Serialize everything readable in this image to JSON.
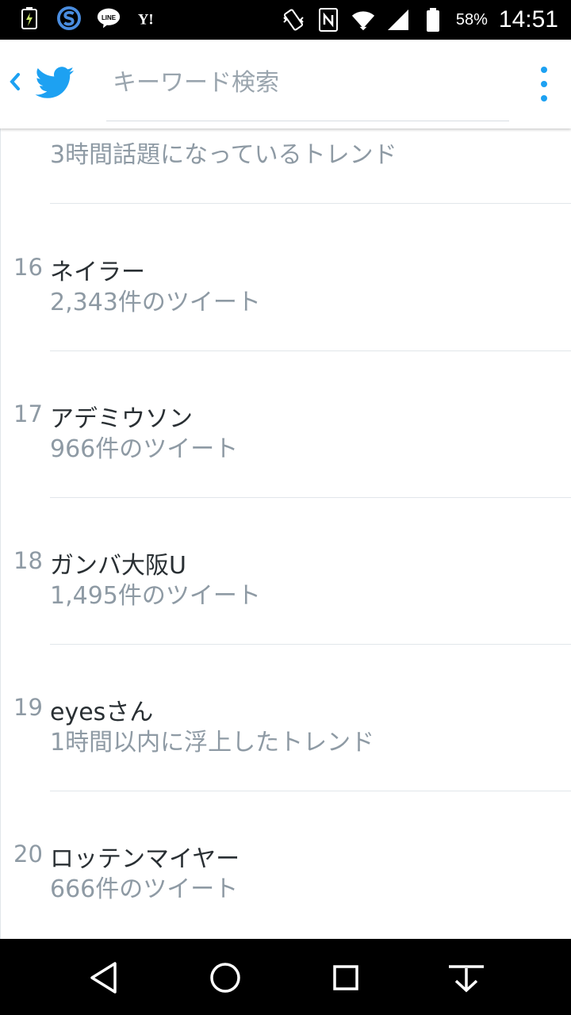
{
  "status_bar": {
    "battery_percent": "58%",
    "time": "14:51",
    "left_icons": [
      "battery-charging-icon",
      "s-app-icon",
      "line-app-icon",
      "yahoo-icon"
    ],
    "right_icons": [
      "vibrate-icon",
      "nfc-icon",
      "wifi-icon",
      "signal-icon",
      "battery-icon"
    ]
  },
  "app_bar": {
    "search_placeholder": "キーワード検索"
  },
  "partial_item": {
    "subtitle": "3時間話題になっているトレンド"
  },
  "trends": [
    {
      "rank": "16",
      "title": "ネイラー",
      "subtitle": "2,343件のツイート"
    },
    {
      "rank": "17",
      "title": "アデミウソン",
      "subtitle": "966件のツイート"
    },
    {
      "rank": "18",
      "title": "ガンバ大阪U",
      "subtitle": "1,495件のツイート"
    },
    {
      "rank": "19",
      "title": "eyesさん",
      "subtitle": "1時間以内に浮上したトレンド"
    },
    {
      "rank": "20",
      "title": "ロッテンマイヤー",
      "subtitle": "666件のツイート"
    }
  ],
  "colors": {
    "twitter_blue": "#1da1f2",
    "primary_text": "#292f33",
    "secondary_text": "#8e9aa4",
    "divider": "#e1e6ea"
  },
  "nav_bar": {
    "icons": [
      "back-triangle-icon",
      "home-circle-icon",
      "recents-square-icon",
      "hide-keyboard-icon"
    ]
  }
}
